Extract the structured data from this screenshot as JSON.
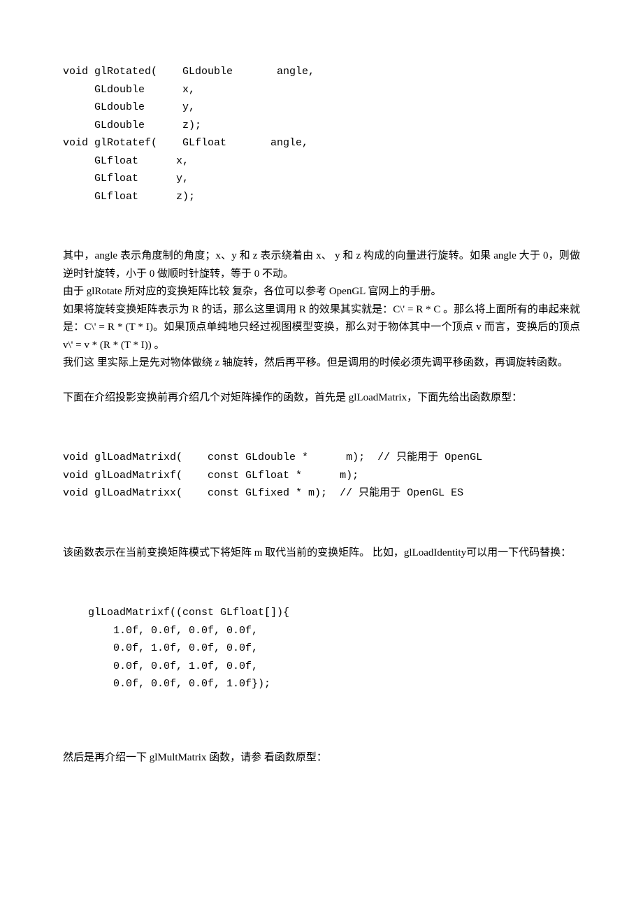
{
  "code1": "void glRotated(    GLdouble       angle,\n     GLdouble      x,\n     GLdouble      y,\n     GLdouble      z);\nvoid glRotatef(    GLfloat       angle,\n     GLfloat      x,\n     GLfloat      y,\n     GLfloat      z);",
  "para1": "其中，angle 表示角度制的角度；x、y 和 z 表示绕着由 x、 y 和 z 构成的向量进行旋转。如果 angle 大于 0，则做逆时针旋转，小于 0 做顺时针旋转，等于 0 不动。",
  "para2": "由于 glRotate 所对应的变换矩阵比较 复杂，各位可以参考 OpenGL 官网上的手册。",
  "para3": "如果将旋转变换矩阵表示为 R 的话，那么这里调用 R 的效果其实就是：C\\' = R * C 。那么将上面所有的串起来就是：C\\' = R * (T * I)。如果顶点单纯地只经过视图模型变换，那么对于物体其中一个顶点 v 而言，变换后的顶点 v\\' = v * (R * (T * I)) 。",
  "para4": "我们这 里实际上是先对物体做绕 z 轴旋转，然后再平移。但是调用的时候必须先调平移函数，再调旋转函数。",
  "para5": "下面在介绍投影变换前再介绍几个对矩阵操作的函数，首先是 glLoadMatrix，下面先给出函数原型：",
  "code2": "void glLoadMatrixd(    const GLdouble *      m);  // 只能用于 OpenGL\nvoid glLoadMatrixf(    const GLfloat *      m);\nvoid glLoadMatrixx(    const GLfixed * m);  // 只能用于 OpenGL ES",
  "para6": "该函数表示在当前变换矩阵模式下将矩阵 m 取代当前的变换矩阵。 比如，glLoadIdentity可以用一下代码替换：",
  "code3": "    glLoadMatrixf((const GLfloat[]){\n        1.0f, 0.0f, 0.0f, 0.0f,\n        0.0f, 1.0f, 0.0f, 0.0f,\n        0.0f, 0.0f, 1.0f, 0.0f,\n        0.0f, 0.0f, 0.0f, 1.0f});",
  "para7": "然后是再介绍一下 glMultMatrix 函数，请参 看函数原型："
}
